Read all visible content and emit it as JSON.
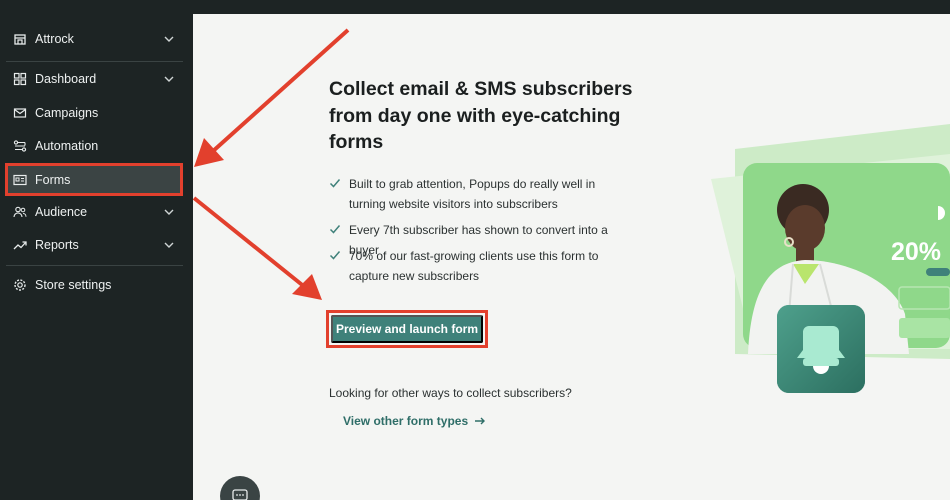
{
  "sidebar": {
    "items": [
      {
        "label": "Attrock",
        "icon": "store-icon",
        "has_chevron": true
      },
      {
        "label": "Dashboard",
        "icon": "grid-icon",
        "has_chevron": true
      },
      {
        "label": "Campaigns",
        "icon": "mail-icon",
        "has_chevron": false
      },
      {
        "label": "Automation",
        "icon": "flow-icon",
        "has_chevron": false
      },
      {
        "label": "Forms",
        "icon": "form-icon",
        "has_chevron": false,
        "active": true
      },
      {
        "label": "Audience",
        "icon": "people-icon",
        "has_chevron": true
      },
      {
        "label": "Reports",
        "icon": "trend-icon",
        "has_chevron": true
      },
      {
        "label": "Store settings",
        "icon": "gear-icon",
        "has_chevron": false
      }
    ]
  },
  "main": {
    "headline": "Collect email & SMS subscribers from day one with eye-catching forms",
    "benefits": [
      "Built to grab attention, Popups do really well in turning website visitors into subscribers",
      "Every 7th subscriber has shown to convert into a buyer",
      "70% of our fast-growing clients use this form to capture new subscribers"
    ],
    "cta_label": "Preview and launch form",
    "other_question": "Looking for other ways to collect subscribers?",
    "other_link": "View other form types"
  },
  "illustration": {
    "promo_text": "20%"
  },
  "colors": {
    "sidebar_bg": "#1d2424",
    "accent_teal": "#3f817a",
    "highlight_red": "#e2402d",
    "illustration_green": "#8fd88a"
  }
}
